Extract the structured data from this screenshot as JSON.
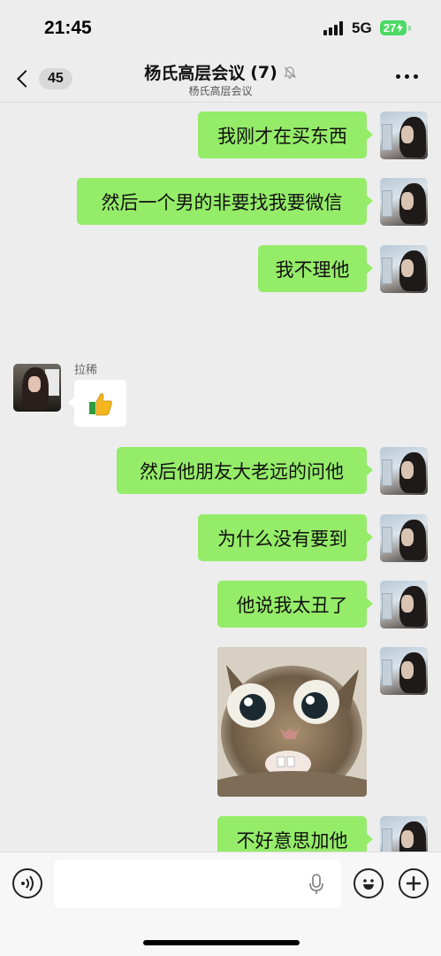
{
  "status_bar": {
    "time": "21:45",
    "network": "5G",
    "battery": "27"
  },
  "nav": {
    "back_badge": "45",
    "title": "杨氏高层会议",
    "member_count": "(7)",
    "subtitle": "杨氏高层会议",
    "muted": true
  },
  "messages": [
    {
      "from": "me",
      "type": "text",
      "text": "我刚才在买东西"
    },
    {
      "from": "me",
      "type": "text",
      "text": "然后一个男的非要找我要微信"
    },
    {
      "from": "me",
      "type": "text",
      "text": "我不理他"
    },
    {
      "from": "other",
      "sender": "拉稀",
      "type": "emoji",
      "icon": "thumbs-up-icon"
    },
    {
      "from": "me",
      "type": "text",
      "text": "然后他朋友大老远的问他"
    },
    {
      "from": "me",
      "type": "text",
      "text": "为什么没有要到"
    },
    {
      "from": "me",
      "type": "text",
      "text": "他说我太丑了"
    },
    {
      "from": "me",
      "type": "sticker",
      "icon": "surprised-cat-sticker"
    },
    {
      "from": "me",
      "type": "text",
      "text": "不好意思加他"
    }
  ],
  "input_bar": {
    "placeholder": "",
    "icons": [
      "voice-icon",
      "microphone-icon",
      "emoji-icon",
      "plus-icon"
    ]
  },
  "colors": {
    "outgoing_bubble": "#95ec69",
    "incoming_bubble": "#ffffff",
    "background": "#ededed",
    "battery": "#4cd964"
  }
}
